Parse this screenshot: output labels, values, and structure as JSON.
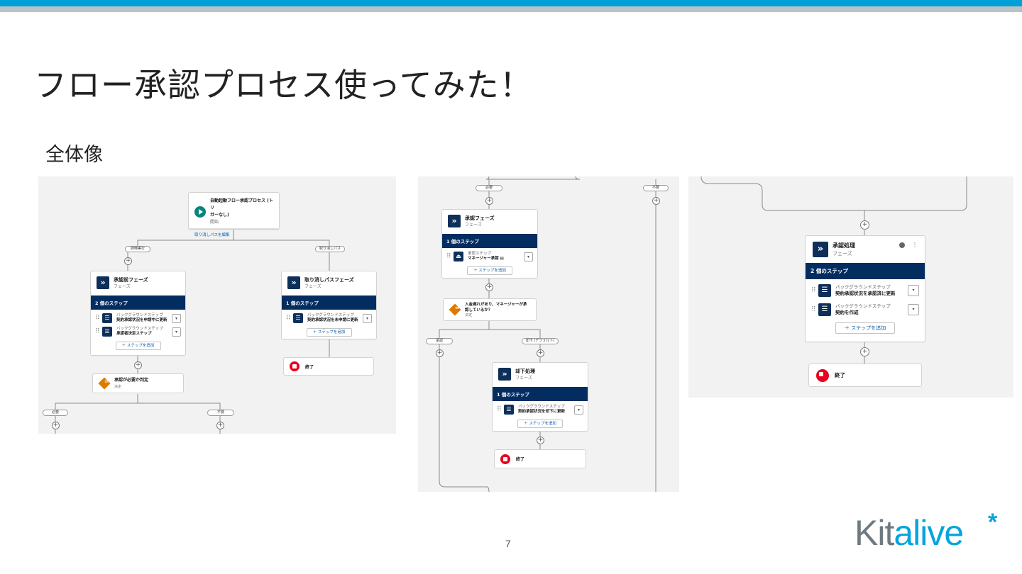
{
  "slide": {
    "title": "フロー承認プロセス使ってみた！",
    "subtitle": "全体像",
    "page_number": "7",
    "logo": {
      "part1": "Kit",
      "part2": "alive",
      "star": "*"
    }
  },
  "panel1": {
    "start_card": {
      "title_line1": "自動起動フロー承認プロセス (トリ",
      "title_line2": "ガーなし)",
      "sub": "開始",
      "link": "取り消しパスを編集"
    },
    "branch_left_label": "即時実行",
    "branch_right_label": "取り消しパス",
    "pre_phase": {
      "title": "承認前フェーズ",
      "sub": "フェーズ",
      "steps_count": "2 個のステップ",
      "steps": [
        {
          "type": "バックグラウンドステップ",
          "name": "契約承認状況を申請中に更新"
        },
        {
          "type": "バックグラウンドステップ",
          "name": "承認者決定ステップ"
        }
      ],
      "add_label": "＋ ステップを追加"
    },
    "cancel_phase": {
      "title": "取り消しパスフェーズ",
      "sub": "フェーズ",
      "steps_count": "1 個のステップ",
      "steps": [
        {
          "type": "バックグラウンドステップ",
          "name": "契約承認状況を未申請に更新"
        }
      ],
      "add_label": "＋ ステップを追加"
    },
    "end_label": "終了",
    "decision": {
      "title": "承認が必要か判定",
      "sub": "決定"
    },
    "decision_left": "必要",
    "decision_right": "不要"
  },
  "panel2": {
    "top_left_label": "必要",
    "top_right_label": "不要",
    "approval_phase": {
      "title": "承認フェーズ",
      "sub": "フェーズ",
      "steps_count": "1 個のステップ",
      "steps": [
        {
          "type": "承認ステップ",
          "name": "マネージャー承認 ▤"
        }
      ],
      "add_label": "＋ ステップを追加"
    },
    "decision": {
      "title_line1": "入金遅れがあり、マネージャーが承",
      "title_line2": "認しているか？",
      "sub": "決定"
    },
    "branch_left": "承認",
    "branch_right": "却下 (デフォルト)",
    "reject_phase": {
      "title": "却下処理",
      "sub": "フェーズ",
      "steps_count": "1 個のステップ",
      "steps": [
        {
          "type": "バックグラウンドステップ",
          "name": "契約承認状況を却下に更新"
        }
      ],
      "add_label": "＋ ステップを追加"
    },
    "end_label": "終了"
  },
  "panel3": {
    "approval_proc": {
      "title": "承認処理",
      "sub": "フェーズ",
      "steps_count": "2 個のステップ",
      "steps": [
        {
          "type": "バックグラウンドステップ",
          "name": "契約承認状況を承認済に更新"
        },
        {
          "type": "バックグラウンドステップ",
          "name": "契約を作成"
        }
      ],
      "add_label": "＋ ステップを追加"
    },
    "end_label": "終了"
  }
}
